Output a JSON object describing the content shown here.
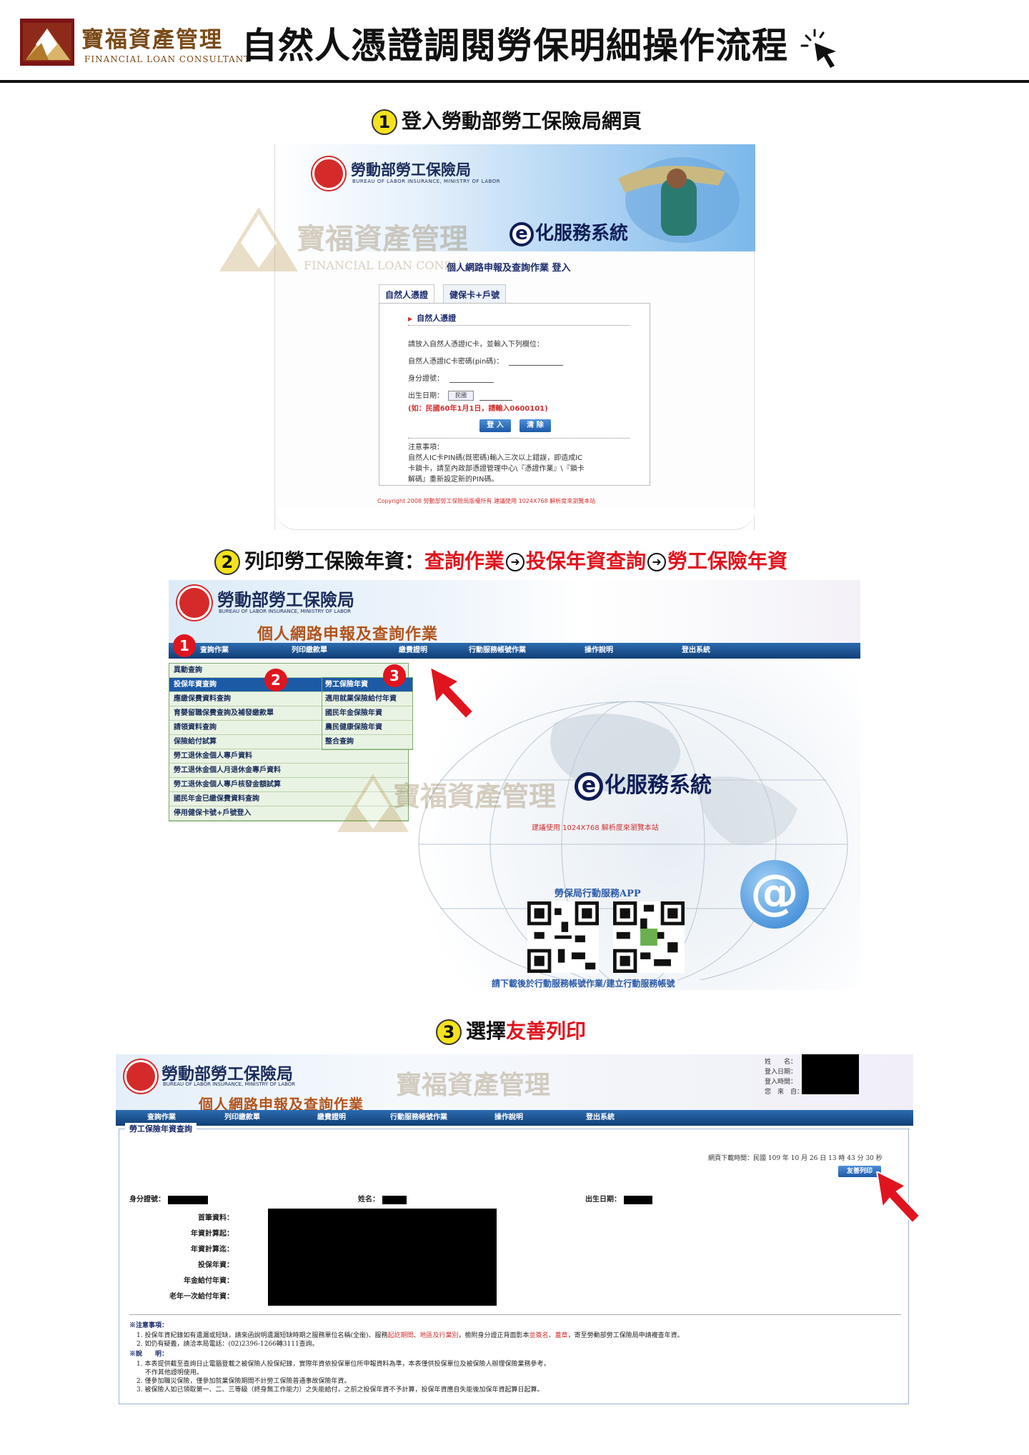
{
  "header": {
    "brand_zh": "寶福資產管理",
    "brand_en": "FINANCIAL LOAN CONSULTANT",
    "title": "自然人憑證調閱勞保明細操作流程"
  },
  "steps": [
    {
      "num": "1",
      "text": "登入勞動部勞工保險局網頁"
    },
    {
      "num": "2",
      "text": "列印勞工保險年資：",
      "path": [
        "查詢作業",
        "投保年資查詢",
        "勞工保險年資"
      ]
    },
    {
      "num": "3",
      "text": "選擇",
      "highlight": "友善列印"
    }
  ],
  "shot1": {
    "agency": "勞動部勞工保險局",
    "agency_en": "BUREAU OF LABOR INSURANCE, MINISTRY OF LABOR",
    "system": "化服務系統",
    "system_e": "e",
    "header": "個人網路申報及查詢作業 登入",
    "tabs": [
      "自然人憑證",
      "健保卡+戶號"
    ],
    "form_title": "自然人憑證",
    "instruction": "請放入自然人憑證IC卡，並輸入下列欄位：",
    "pin_label": "自然人憑證IC卡密碼(pin碼)：",
    "id_label": "身分證號：",
    "birth_label": "出生日期：",
    "birth_select": "民國",
    "birth_hint": "(如：民國60年1月1日，請輸入0600101)",
    "login_button": "登 入",
    "clear_button": "清 除",
    "notice_title": "注意事項：",
    "notice_lines": [
      "自然人IC卡PIN碼(既密碼)輸入三次以上錯誤，即造成IC",
      "卡鎖卡，請至內政部憑證管理中心\\『憑證作業』\\『鎖卡",
      "解碼』重新設定新的PIN碼。"
    ],
    "copyright": "Copyright 2008 勞動部勞工保險局版權所有 建議使用 1024X768 解析度來瀏覽本站"
  },
  "watermark": {
    "zh": "寶福資產管理",
    "en": "FINANCIAL LOAN CONSU"
  },
  "shot2": {
    "agency": "勞動部勞工保險局",
    "agency_en": "BUREAU OF LABOR INSURANCE, MINISTRY OF LABOR",
    "subtitle": "個人網路申報及查詢作業",
    "nav": [
      "查詢作業",
      "列印繳款單",
      "繳費證明",
      "行動服務帳號作業",
      "操作說明",
      "登出系統"
    ],
    "menu_main": [
      "異動查詢",
      "投保年資查詢",
      "應繳保費資料查詢",
      "育嬰留職保費查詢及補發繳款單",
      "請領資料查詢",
      "保險給付試算",
      "勞工退休金個人專戶資料",
      "勞工退休金個人月退休金專戶資料",
      "勞工退休金個人專戶核發金額試算",
      "國民年金已繳保費資料查詢",
      "停用健保卡號+戶號登入"
    ],
    "menu_sub": [
      "勞工保險年資",
      "適用就業保險給付年資",
      "國民年金保險年資",
      "農民健康保險年資",
      "整合查詢"
    ],
    "badges": [
      "1",
      "2",
      "3"
    ],
    "system": "化服務系統",
    "system_e": "e",
    "resolution": "建議使用 1024X768 解析度來瀏覽本站",
    "app_title": "勞保局行動服務APP",
    "download": "請下載後於行動服務帳號作業/建立行動服務帳號"
  },
  "shot3": {
    "agency": "勞動部勞工保險局",
    "agency_en": "BUREAU OF LABOR INSURANCE, MINISTRY OF LABOR",
    "subtitle": "個人網路申報及查詢作業",
    "info_labels": [
      "姓　　名：",
      "登入日期：",
      "登入時間：",
      "您　來　自："
    ],
    "nav": [
      "查詢作業",
      "列印繳款單",
      "繳費證明",
      "行動服務帳號作業",
      "操作說明",
      "登出系統"
    ],
    "panel_title": "勞工保險年資查詢",
    "download_time": "網頁下載時間：民國 109 年 10 月 26 日 13 時 43 分 30 秒",
    "print_button": "友善列印",
    "id_label": "身分證號：",
    "name_label": "姓名：",
    "birth_label": "出生日期：",
    "rows": [
      "首筆資料：",
      "年資計算起：",
      "年資計算迄：",
      "投保年資：",
      "年金給付年資：",
      "老年一次給付年資："
    ],
    "notes_title": "※注意事項：",
    "notes": [
      "1. 投保年資紀錄如有遺漏或短缺，請來函說明遺漏短缺時期之服務單位名稱(全銜)、服務",
      "2. 如仍有疑義，請洽本局電話：(02)2396-1266轉3111查詢。"
    ],
    "note1_red1": "起訖期間",
    "note1_mid": "、",
    "note1_red2": "地區及行業別",
    "note1_tail": "，檢附身分證正背面影本",
    "note1_red3": "並簽名",
    "note1_dot": "、",
    "note1_red4": "蓋章",
    "note1_end": "，寄至勞動部勞工保險局申請複查年資。",
    "expl_title": "※說　　明：",
    "expl": [
      "1. 本表提供截至查詢日止電腦登載之被保險人投保紀錄，實際年資依投保單位所申報資料為準，本表僅供投保單位及被保險人辦理保險業務參考，",
      "　 不作其他證明使用。",
      "2. 僅參加職災保險，僅參加就業保險期間不計勞工保險普通事故保險年資。",
      "3. 被保險人如已領取第一、二、三等級（終身無工作能力）之失能給付，之前之投保年資不予計算，投保年資應自失能後加保年資起算日起算。"
    ]
  },
  "colors": {
    "brand": "#7a4a17",
    "accent_red": "#e0141e",
    "step_yellow": "#f3e21c",
    "nav_blue": "#1d5aa6",
    "menu_green": "#e9f3e3"
  },
  "icons": [
    "brand-logo-icon",
    "cursor-click-icon",
    "lbi-logo-icon",
    "red-pointer-arrow-icon",
    "qr-code-icon",
    "at-sign-icon"
  ]
}
